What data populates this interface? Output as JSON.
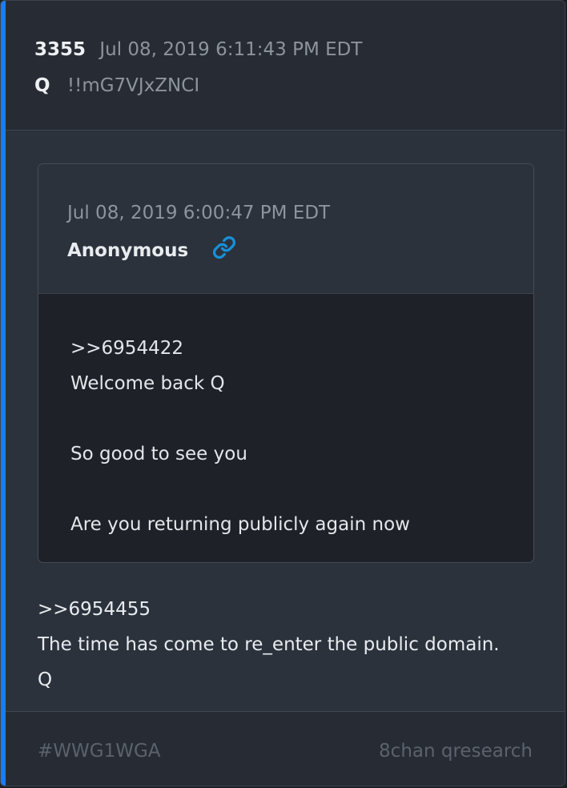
{
  "post": {
    "number": "3355",
    "date": "Jul 08, 2019 6:11:43 PM EDT",
    "author": "Q",
    "tripcode": "!!mG7VJxZNCI",
    "body": ">>6954455\nThe time has come to re_enter the public domain.\nQ"
  },
  "quoted_post": {
    "date": "Jul 08, 2019 6:00:47 PM EDT",
    "author": "Anonymous",
    "link_icon": "link-icon",
    "body": ">>6954422\nWelcome back Q\n\nSo good to see you\n\nAre you returning publicly again now"
  },
  "footer": {
    "hashtag": "#WWG1WGA",
    "source": "8chan qresearch"
  },
  "colors": {
    "accent": "#1d7bf2",
    "link": "#1a8fd8",
    "card_bg": "#2b323c",
    "quoted_bg": "#1e2127"
  }
}
